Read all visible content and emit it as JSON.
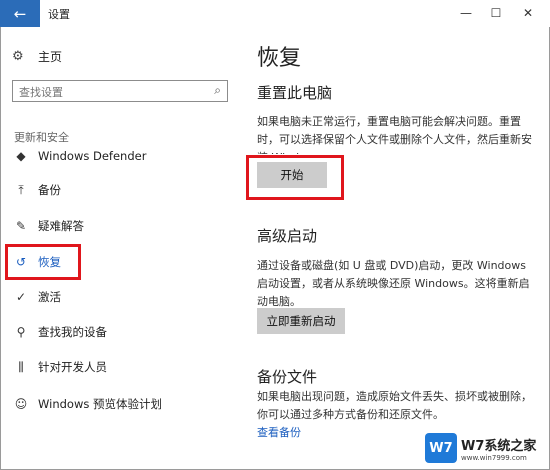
{
  "window": {
    "back_icon": "←",
    "title": "设置",
    "minimize": "—",
    "maximize": "☐",
    "close": "✕"
  },
  "sidebar": {
    "home": {
      "icon": "⚙",
      "label": "主页"
    },
    "search_placeholder": "查找设置",
    "search_icon": "⌕",
    "section_title": "更新和安全",
    "items": [
      {
        "icon": "◆",
        "label": "Windows Defender"
      },
      {
        "icon": "⤒",
        "label": "备份"
      },
      {
        "icon": "✎",
        "label": "疑难解答"
      },
      {
        "icon": "↺",
        "label": "恢复",
        "active": true
      },
      {
        "icon": "✓",
        "label": "激活"
      },
      {
        "icon": "⚲",
        "label": "查找我的设备"
      },
      {
        "icon": "⫼",
        "label": "针对开发人员"
      },
      {
        "icon": "☺",
        "label": "Windows 预览体验计划"
      }
    ]
  },
  "main": {
    "title": "恢复",
    "reset": {
      "heading": "重置此电脑",
      "desc": "如果电脑未正常运行，重置电脑可能会解决问题。重置时，可以选择保留个人文件或删除个人文件，然后重新安装 Windows。",
      "button": "开始"
    },
    "advanced": {
      "heading": "高级启动",
      "desc": "通过设备或磁盘(如 U 盘或 DVD)启动，更改 Windows 启动设置，或者从系统映像还原 Windows。这将重新启动电脑。",
      "button": "立即重新启动"
    },
    "backup": {
      "heading": "备份文件",
      "desc": "如果电脑出现问题，造成原始文件丢失、损坏或被删除，你可以通过多种方式备份和还原文件。",
      "link": "查看备份"
    }
  },
  "watermark": {
    "logo": "W7",
    "line1": "W7系统之家",
    "line2": "www.win7999.com"
  }
}
